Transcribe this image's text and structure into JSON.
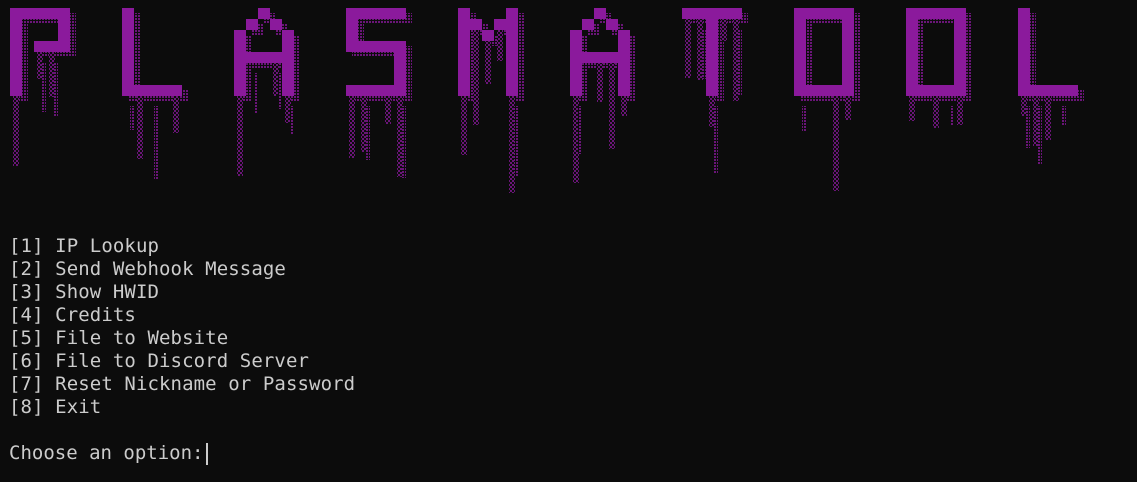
{
  "banner": {
    "text": "PLASMATOOL",
    "accent_color": "#8b1a9c",
    "drip_color": "#6a1578"
  },
  "menu": {
    "options": [
      {
        "key": "[1]",
        "label": "IP Lookup"
      },
      {
        "key": "[2]",
        "label": "Send Webhook Message"
      },
      {
        "key": "[3]",
        "label": "Show HWID"
      },
      {
        "key": "[4]",
        "label": "Credits"
      },
      {
        "key": "[5]",
        "label": "File to Website"
      },
      {
        "key": "[6]",
        "label": "File to Discord Server"
      },
      {
        "key": "[7]",
        "label": "Reset Nickname or Password"
      },
      {
        "key": "[8]",
        "label": "Exit"
      }
    ]
  },
  "prompt": {
    "text": "Choose an option:"
  },
  "colors": {
    "background": "#0c0c0c",
    "foreground": "#cccccc"
  }
}
